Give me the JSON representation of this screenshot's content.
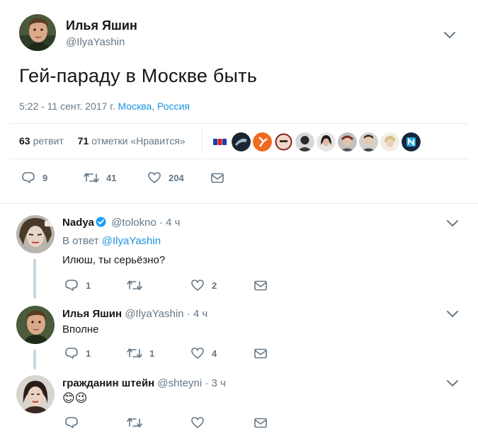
{
  "main_tweet": {
    "author_name": "Илья Яшин",
    "author_handle": "@IlyaYashin",
    "text": "Гей-параду в Москве быть",
    "timestamp": "5:22 - 11 сент. 2017 г.",
    "location": "Москва, Россия",
    "retweets_count": "63",
    "retweets_label": "ретвит",
    "likes_count": "71",
    "likes_label": "отметки «Нравится»",
    "actions": {
      "reply_count": "9",
      "retweet_count": "41",
      "like_count": "204"
    },
    "likers": [
      "liker-1",
      "liker-2",
      "liker-3",
      "liker-4",
      "liker-5",
      "liker-6",
      "liker-7",
      "liker-8",
      "liker-9",
      "liker-10"
    ]
  },
  "replies": [
    {
      "name": "Nadya",
      "handle": "@tolokno",
      "time": "4 ч",
      "verified": true,
      "in_reply_prefix": "В ответ",
      "in_reply_to": "@IlyaYashin",
      "text": "Илюш, ты серьёзно?",
      "reply_count": "1",
      "retweet_count": "",
      "like_count": "2"
    },
    {
      "name": "Илья Яшин",
      "handle": "@IlyaYashin",
      "time": "4 ч",
      "text": "Вполне",
      "reply_count": "1",
      "retweet_count": "1",
      "like_count": "4"
    },
    {
      "name": "гражданин штейн",
      "handle": "@shteyni",
      "time": "3 ч",
      "text": "😊😉",
      "reply_count": "",
      "retweet_count": "",
      "like_count": ""
    }
  ],
  "separator": " · ",
  "colors": {
    "link": "#1b95e0",
    "muted": "#657786",
    "text": "#14171a",
    "border": "#e6ecf0"
  }
}
